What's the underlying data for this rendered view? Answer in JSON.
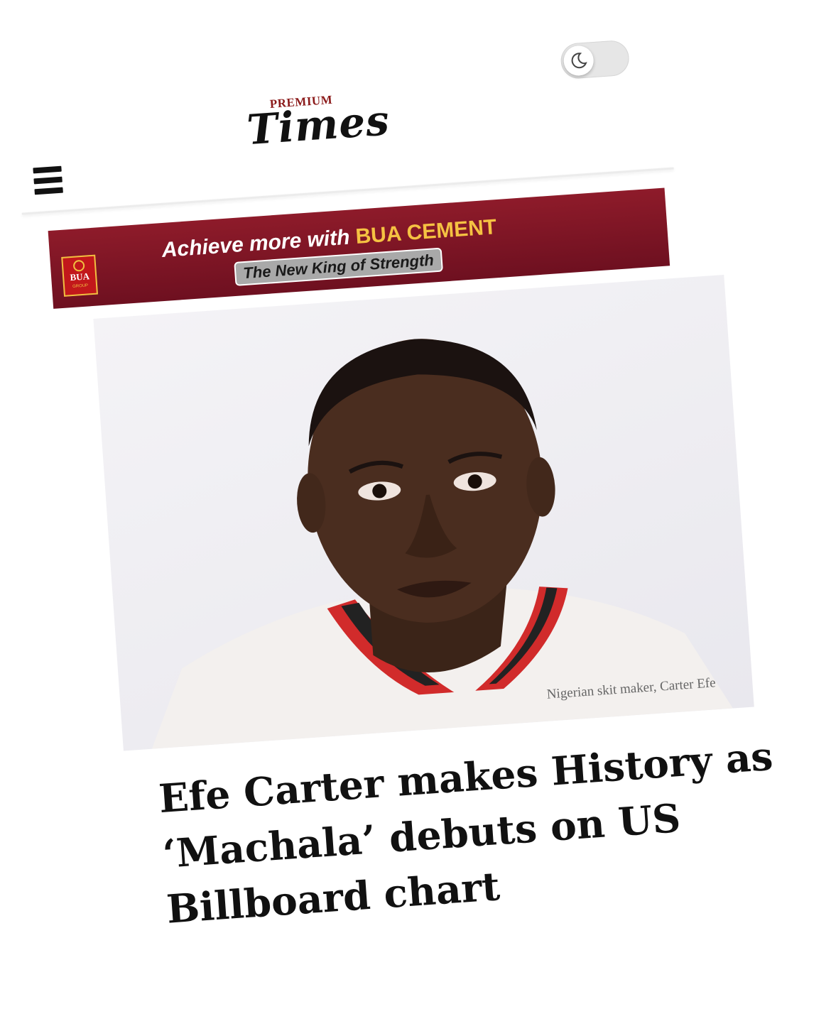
{
  "header": {
    "logo_kicker": "PREMIUM",
    "logo_main": "Times",
    "menu_icon": "hamburger-menu-icon",
    "theme_toggle_icon": "moon-icon"
  },
  "ad": {
    "headline_prefix": "Achieve more with ",
    "headline_brand": "BUA CEMENT",
    "tagline": "The New King of Strength",
    "logo_text": "BUA",
    "logo_sub": "GROUP",
    "colors": {
      "background": "#8e1b2a",
      "brand_accent": "#f5c242"
    }
  },
  "article": {
    "image_caption": "Nigerian skit maker, Carter Efe",
    "headline": "Efe Carter makes History as ‘Machala’ debuts on US Billboard chart"
  }
}
